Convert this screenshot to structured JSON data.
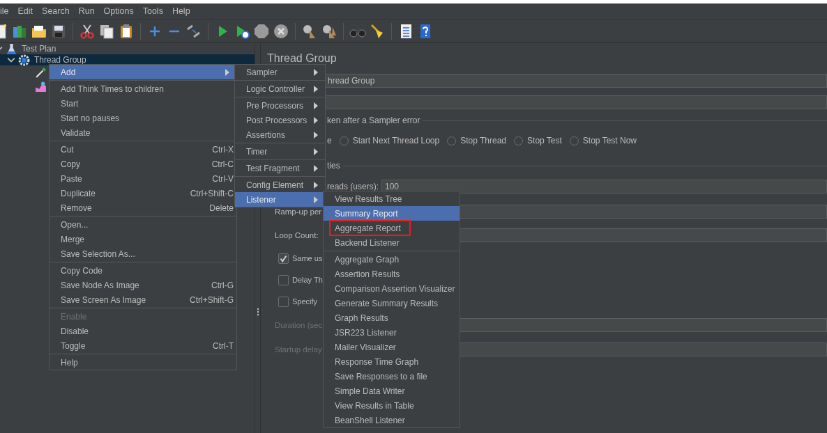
{
  "menu_bar": [
    "ile",
    "Edit",
    "Search",
    "Run",
    "Options",
    "Tools",
    "Help"
  ],
  "tree": [
    {
      "kind": "plan",
      "label": "Test Plan",
      "expanded": true,
      "selected": false,
      "children": [
        {
          "kind": "thread-group",
          "label": "Thread Group",
          "expanded": true,
          "selected": true,
          "children": [
            {
              "kind": "sampler"
            },
            {
              "kind": "listener"
            }
          ]
        }
      ]
    }
  ],
  "panel": {
    "title": "Thread Group",
    "name_value": "hread Group",
    "error_label": "ken after a Sampler error",
    "action_fragment": "e",
    "actions": [
      {
        "label": "Start Next Thread Loop",
        "selected": false
      },
      {
        "label": "Stop Thread",
        "selected": false
      },
      {
        "label": "Stop Test",
        "selected": false
      },
      {
        "label": "Stop Test Now",
        "selected": false
      }
    ],
    "properties_label": "ties",
    "threads_label": "reads (users):",
    "threads_value": "100",
    "rampup_label": "Ramp-up per",
    "loop_label": "Loop Count:",
    "options": [
      {
        "label": "Same us",
        "checked": true
      },
      {
        "label": "Delay Th",
        "checked": false
      },
      {
        "label": "Specify",
        "checked": false
      }
    ],
    "timing_rows": [
      {
        "label": "Duration (sec",
        "disabled": true
      },
      {
        "label": "Startup delay",
        "disabled": true
      }
    ]
  },
  "context_menu": {
    "items": [
      {
        "kind": "item",
        "label": "Add",
        "selected": true,
        "disabled": false,
        "submenu": true
      },
      {
        "kind": "separator"
      },
      {
        "kind": "item",
        "label": "Add Think Times to children",
        "selected": false,
        "disabled": false,
        "submenu": false
      },
      {
        "kind": "item",
        "label": "Start",
        "selected": false,
        "disabled": false,
        "submenu": false
      },
      {
        "kind": "item",
        "label": "Start no pauses",
        "selected": false,
        "disabled": false,
        "submenu": false
      },
      {
        "kind": "item",
        "label": "Validate",
        "selected": false,
        "disabled": false,
        "submenu": false
      },
      {
        "kind": "separator"
      },
      {
        "kind": "item",
        "label": "Cut",
        "shortcut": "Ctrl-X",
        "selected": false,
        "disabled": false,
        "submenu": false
      },
      {
        "kind": "item",
        "label": "Copy",
        "shortcut": "Ctrl-C",
        "selected": false,
        "disabled": false,
        "submenu": false
      },
      {
        "kind": "item",
        "label": "Paste",
        "shortcut": "Ctrl-V",
        "selected": false,
        "disabled": false,
        "submenu": false
      },
      {
        "kind": "item",
        "label": "Duplicate",
        "shortcut": "Ctrl+Shift-C",
        "selected": false,
        "disabled": false,
        "submenu": false
      },
      {
        "kind": "item",
        "label": "Remove",
        "shortcut": "Delete",
        "selected": false,
        "disabled": false,
        "submenu": false
      },
      {
        "kind": "separator"
      },
      {
        "kind": "item",
        "label": "Open...",
        "selected": false,
        "disabled": false,
        "submenu": false
      },
      {
        "kind": "item",
        "label": "Merge",
        "selected": false,
        "disabled": false,
        "submenu": false
      },
      {
        "kind": "item",
        "label": "Save Selection As...",
        "selected": false,
        "disabled": false,
        "submenu": false
      },
      {
        "kind": "separator"
      },
      {
        "kind": "item",
        "label": "Copy Code",
        "selected": false,
        "disabled": false,
        "submenu": false
      },
      {
        "kind": "item",
        "label": "Save Node As Image",
        "shortcut": "Ctrl-G",
        "selected": false,
        "disabled": false,
        "submenu": false
      },
      {
        "kind": "item",
        "label": "Save Screen As Image",
        "shortcut": "Ctrl+Shift-G",
        "selected": false,
        "disabled": false,
        "submenu": false
      },
      {
        "kind": "separator"
      },
      {
        "kind": "item",
        "label": "Enable",
        "selected": false,
        "disabled": true,
        "submenu": false
      },
      {
        "kind": "item",
        "label": "Disable",
        "selected": false,
        "disabled": false,
        "submenu": false
      },
      {
        "kind": "item",
        "label": "Toggle",
        "shortcut": "Ctrl-T",
        "selected": false,
        "disabled": false,
        "submenu": false
      },
      {
        "kind": "separator"
      },
      {
        "kind": "item",
        "label": "Help",
        "selected": false,
        "disabled": false,
        "submenu": false
      }
    ]
  },
  "add_menu": {
    "items": [
      {
        "kind": "item",
        "label": "Sampler",
        "selected": false,
        "submenu": true
      },
      {
        "kind": "separator"
      },
      {
        "kind": "item",
        "label": "Logic Controller",
        "selected": false,
        "submenu": true
      },
      {
        "kind": "separator"
      },
      {
        "kind": "item",
        "label": "Pre Processors",
        "selected": false,
        "submenu": true
      },
      {
        "kind": "item",
        "label": "Post Processors",
        "selected": false,
        "submenu": true
      },
      {
        "kind": "item",
        "label": "Assertions",
        "selected": false,
        "submenu": true
      },
      {
        "kind": "separator"
      },
      {
        "kind": "item",
        "label": "Timer",
        "selected": false,
        "submenu": true
      },
      {
        "kind": "separator"
      },
      {
        "kind": "item",
        "label": "Test Fragment",
        "selected": false,
        "submenu": true
      },
      {
        "kind": "separator"
      },
      {
        "kind": "item",
        "label": "Config Element",
        "selected": false,
        "submenu": true
      },
      {
        "kind": "item",
        "label": "Listener",
        "selected": true,
        "submenu": true
      }
    ]
  },
  "listener_menu": {
    "items": [
      {
        "kind": "item",
        "label": "View Results Tree",
        "selected": false,
        "annotated": false
      },
      {
        "kind": "item",
        "label": "Summary Report",
        "selected": true,
        "annotated": false
      },
      {
        "kind": "item",
        "label": "Aggregate Report",
        "selected": false,
        "annotated": true
      },
      {
        "kind": "item",
        "label": "Backend Listener",
        "selected": false,
        "annotated": false
      },
      {
        "kind": "separator"
      },
      {
        "kind": "item",
        "label": "Aggregate Graph",
        "selected": false,
        "annotated": false
      },
      {
        "kind": "item",
        "label": "Assertion Results",
        "selected": false,
        "annotated": false
      },
      {
        "kind": "item",
        "label": "Comparison Assertion Visualizer",
        "selected": false,
        "annotated": false
      },
      {
        "kind": "item",
        "label": "Generate Summary Results",
        "selected": false,
        "annotated": false
      },
      {
        "kind": "item",
        "label": "Graph Results",
        "selected": false,
        "annotated": false
      },
      {
        "kind": "item",
        "label": "JSR223 Listener",
        "selected": false,
        "annotated": false
      },
      {
        "kind": "item",
        "label": "Mailer Visualizer",
        "selected": false,
        "annotated": false
      },
      {
        "kind": "item",
        "label": "Response Time Graph",
        "selected": false,
        "annotated": false
      },
      {
        "kind": "item",
        "label": "Save Responses to a file",
        "selected": false,
        "annotated": false
      },
      {
        "kind": "item",
        "label": "Simple Data Writer",
        "selected": false,
        "annotated": false
      },
      {
        "kind": "item",
        "label": "View Results in Table",
        "selected": false,
        "annotated": false
      },
      {
        "kind": "item",
        "label": "BeanShell Listener",
        "selected": false,
        "annotated": false
      }
    ]
  }
}
